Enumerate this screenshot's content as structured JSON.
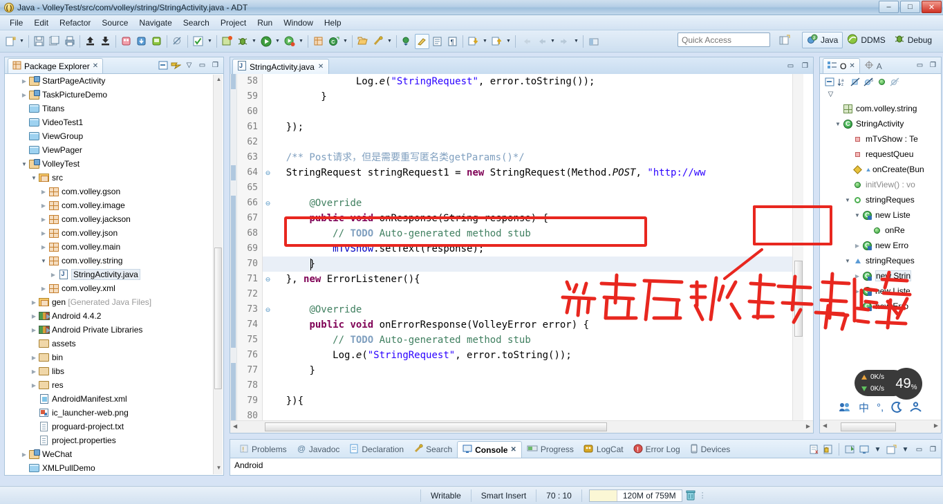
{
  "window": {
    "title": "Java - VolleyTest/src/com/volley/string/StringActivity.java - ADT",
    "app_icon": "adt-icon",
    "minimize": "–",
    "maximize": "□",
    "close": "✕"
  },
  "menu": [
    "File",
    "Edit",
    "Refactor",
    "Source",
    "Navigate",
    "Search",
    "Project",
    "Run",
    "Window",
    "Help"
  ],
  "toolbar": {
    "quick_access_placeholder": "Quick Access",
    "perspectives": [
      {
        "label": "Java",
        "active": true
      },
      {
        "label": "DDMS",
        "active": false
      },
      {
        "label": "Debug",
        "active": false
      }
    ]
  },
  "package_explorer": {
    "tab_label": "Package Explorer",
    "tree": [
      {
        "label": "StartPageActivity",
        "indent": 1,
        "arrow": "collapsed",
        "icon": "project-icon"
      },
      {
        "label": "TaskPictureDemo",
        "indent": 1,
        "arrow": "collapsed",
        "icon": "project-icon"
      },
      {
        "label": "Titans",
        "indent": 1,
        "arrow": "none",
        "icon": "folder-blue-icon"
      },
      {
        "label": "VideoTest1",
        "indent": 1,
        "arrow": "none",
        "icon": "folder-blue-icon"
      },
      {
        "label": "ViewGroup",
        "indent": 1,
        "arrow": "none",
        "icon": "folder-blue-icon"
      },
      {
        "label": "ViewPager",
        "indent": 1,
        "arrow": "none",
        "icon": "folder-blue-icon"
      },
      {
        "label": "VolleyTest",
        "indent": 1,
        "arrow": "expanded",
        "icon": "project-icon"
      },
      {
        "label": "src",
        "indent": 2,
        "arrow": "expanded",
        "icon": "source-folder-icon"
      },
      {
        "label": "com.volley.gson",
        "indent": 3,
        "arrow": "collapsed",
        "icon": "package-icon"
      },
      {
        "label": "com.volley.image",
        "indent": 3,
        "arrow": "collapsed",
        "icon": "package-icon"
      },
      {
        "label": "com.volley.jackson",
        "indent": 3,
        "arrow": "collapsed",
        "icon": "package-icon"
      },
      {
        "label": "com.volley.json",
        "indent": 3,
        "arrow": "collapsed",
        "icon": "package-icon"
      },
      {
        "label": "com.volley.main",
        "indent": 3,
        "arrow": "collapsed",
        "icon": "package-icon"
      },
      {
        "label": "com.volley.string",
        "indent": 3,
        "arrow": "expanded",
        "icon": "package-icon"
      },
      {
        "label": "StringActivity.java",
        "indent": 4,
        "arrow": "collapsed",
        "icon": "java-file-icon",
        "selected": true
      },
      {
        "label": "com.volley.xml",
        "indent": 3,
        "arrow": "collapsed",
        "icon": "package-icon"
      },
      {
        "label": "gen [Generated Java Files]",
        "indent": 2,
        "arrow": "collapsed",
        "icon": "source-folder-icon",
        "grey_suffix": true
      },
      {
        "label": "Android 4.4.2",
        "indent": 2,
        "arrow": "collapsed",
        "icon": "library-icon"
      },
      {
        "label": "Android Private Libraries",
        "indent": 2,
        "arrow": "collapsed",
        "icon": "library-icon"
      },
      {
        "label": "assets",
        "indent": 2,
        "arrow": "none",
        "icon": "folder-icon"
      },
      {
        "label": "bin",
        "indent": 2,
        "arrow": "collapsed",
        "icon": "folder-icon"
      },
      {
        "label": "libs",
        "indent": 2,
        "arrow": "collapsed",
        "icon": "folder-icon"
      },
      {
        "label": "res",
        "indent": 2,
        "arrow": "collapsed",
        "icon": "folder-icon"
      },
      {
        "label": "AndroidManifest.xml",
        "indent": 2,
        "arrow": "none",
        "icon": "xml-file-icon"
      },
      {
        "label": "ic_launcher-web.png",
        "indent": 2,
        "arrow": "none",
        "icon": "png-file-icon"
      },
      {
        "label": "proguard-project.txt",
        "indent": 2,
        "arrow": "none",
        "icon": "text-file-icon"
      },
      {
        "label": "project.properties",
        "indent": 2,
        "arrow": "none",
        "icon": "text-file-icon"
      },
      {
        "label": "WeChat",
        "indent": 1,
        "arrow": "collapsed",
        "icon": "project-icon"
      },
      {
        "label": "XMLPullDemo",
        "indent": 1,
        "arrow": "none",
        "icon": "folder-blue-icon"
      }
    ]
  },
  "editor": {
    "tab_label": "StringActivity.java",
    "tab_close": "✕",
    "lines": [
      {
        "no": "58",
        "fold": "",
        "indent": 8,
        "tokens": [
          {
            "t": "Log.",
            "c": "plain"
          },
          {
            "t": "e",
            "c": "it"
          },
          {
            "t": "(",
            "c": "plain"
          },
          {
            "t": "\"StringRequest\"",
            "c": "s"
          },
          {
            "t": ", error.toString());",
            "c": "plain"
          }
        ]
      },
      {
        "no": "59",
        "fold": "",
        "indent": 5,
        "tokens": [
          {
            "t": "}",
            "c": "plain"
          }
        ]
      },
      {
        "no": "60",
        "fold": "",
        "indent": 0,
        "tokens": []
      },
      {
        "no": "61",
        "fold": "",
        "indent": 2,
        "tokens": [
          {
            "t": "});",
            "c": "plain"
          }
        ]
      },
      {
        "no": "62",
        "fold": "",
        "indent": 0,
        "tokens": []
      },
      {
        "no": "63",
        "fold": "",
        "indent": 2,
        "tokens": [
          {
            "t": "/** Post请求，但是需要重写匿名类getParams()*/",
            "c": "jd"
          }
        ]
      },
      {
        "no": "64",
        "fold": "⊖",
        "indent": 2,
        "tokens": [
          {
            "t": "StringRequest stringRequest1 = ",
            "c": "plain"
          },
          {
            "t": "new",
            "c": "k"
          },
          {
            "t": " StringRequest(Method.",
            "c": "plain"
          },
          {
            "t": "POST",
            "c": "it"
          },
          {
            "t": ", ",
            "c": "plain"
          },
          {
            "t": "\"http://ww",
            "c": "s"
          }
        ]
      },
      {
        "no": "65",
        "fold": "",
        "indent": 0,
        "tokens": []
      },
      {
        "no": "66",
        "fold": "⊖",
        "indent": 4,
        "tokens": [
          {
            "t": "@Override",
            "c": "cm"
          }
        ]
      },
      {
        "no": "67",
        "fold": "",
        "indent": 4,
        "tokens": [
          {
            "t": "public void",
            "c": "k"
          },
          {
            "t": " onResponse(String response) {",
            "c": "plain"
          }
        ]
      },
      {
        "no": "68",
        "fold": "",
        "indent": 6,
        "tokens": [
          {
            "t": "// ",
            "c": "cm"
          },
          {
            "t": "TODO",
            "c": "td"
          },
          {
            "t": " Auto-generated method stub",
            "c": "cm"
          }
        ]
      },
      {
        "no": "69",
        "fold": "",
        "indent": 6,
        "tokens": [
          {
            "t": "mTvShow",
            "c": "fl"
          },
          {
            "t": ".setText(response);",
            "c": "plain"
          }
        ]
      },
      {
        "no": "70",
        "fold": "",
        "indent": 4,
        "tokens": [
          {
            "t": "}",
            "c": "plain"
          }
        ],
        "current": true
      },
      {
        "no": "71",
        "fold": "⊖",
        "indent": 2,
        "tokens": [
          {
            "t": "}, ",
            "c": "plain"
          },
          {
            "t": "new",
            "c": "k"
          },
          {
            "t": " ErrorListener(){",
            "c": "plain"
          }
        ]
      },
      {
        "no": "72",
        "fold": "",
        "indent": 0,
        "tokens": []
      },
      {
        "no": "73",
        "fold": "⊖",
        "indent": 4,
        "tokens": [
          {
            "t": "@Override",
            "c": "cm"
          }
        ]
      },
      {
        "no": "74",
        "fold": "",
        "indent": 4,
        "tokens": [
          {
            "t": "public void",
            "c": "k"
          },
          {
            "t": " onErrorResponse(VolleyError error) {",
            "c": "plain"
          }
        ]
      },
      {
        "no": "75",
        "fold": "",
        "indent": 6,
        "tokens": [
          {
            "t": "// ",
            "c": "cm"
          },
          {
            "t": "TODO",
            "c": "td"
          },
          {
            "t": " Auto-generated method stub",
            "c": "cm"
          }
        ]
      },
      {
        "no": "76",
        "fold": "",
        "indent": 6,
        "tokens": [
          {
            "t": "Log.",
            "c": "plain"
          },
          {
            "t": "e",
            "c": "it"
          },
          {
            "t": "(",
            "c": "plain"
          },
          {
            "t": "\"StringRequest\"",
            "c": "s"
          },
          {
            "t": ", error.toString());",
            "c": "plain"
          }
        ]
      },
      {
        "no": "77",
        "fold": "",
        "indent": 4,
        "tokens": [
          {
            "t": "}",
            "c": "plain"
          }
        ]
      },
      {
        "no": "78",
        "fold": "",
        "indent": 0,
        "tokens": []
      },
      {
        "no": "79",
        "fold": "",
        "indent": 2,
        "tokens": [
          {
            "t": "}){",
            "c": "plain"
          }
        ]
      },
      {
        "no": "80",
        "fold": "",
        "indent": 0,
        "tokens": []
      }
    ]
  },
  "outline": {
    "tab_label": "O",
    "tab_label2": "A",
    "tree": [
      {
        "label": "com.volley.string",
        "indent": 1,
        "arrow": "none",
        "icon": "package-icon"
      },
      {
        "label": "StringActivity",
        "indent": 1,
        "arrow": "expanded",
        "icon": "class-icon"
      },
      {
        "label": "mTvShow : Te",
        "indent": 2,
        "arrow": "none",
        "icon": "field-private-icon"
      },
      {
        "label": "requestQueu",
        "indent": 2,
        "arrow": "none",
        "icon": "field-private-icon"
      },
      {
        "label": "onCreate(Bun",
        "indent": 2,
        "arrow": "none",
        "icon": "method-protected-icon"
      },
      {
        "label": "initView() : vo",
        "indent": 2,
        "arrow": "none",
        "icon": "method-public-icon",
        "grey": true
      },
      {
        "label": "stringReques",
        "indent": 2,
        "arrow": "expanded",
        "icon": "local-var-icon"
      },
      {
        "label": "new Liste",
        "indent": 3,
        "arrow": "expanded",
        "icon": "anon-class-icon"
      },
      {
        "label": "onRe",
        "indent": 4,
        "arrow": "none",
        "icon": "method-public-icon"
      },
      {
        "label": "new Erro",
        "indent": 3,
        "arrow": "collapsed",
        "icon": "anon-class-icon"
      },
      {
        "label": "stringReques",
        "indent": 2,
        "arrow": "expanded",
        "icon": "local-var2-icon"
      },
      {
        "label": "new Strin",
        "indent": 3,
        "arrow": "collapsed",
        "icon": "anon-class-icon",
        "selected": true
      },
      {
        "label": "new Liste",
        "indent": 3,
        "arrow": "collapsed",
        "icon": "anon-class-icon"
      },
      {
        "label": "new Erro",
        "indent": 3,
        "arrow": "none",
        "icon": "anon-class-icon"
      }
    ]
  },
  "console": {
    "tabs": [
      {
        "label": "Problems",
        "icon": "problems-icon",
        "active": false
      },
      {
        "label": "Javadoc",
        "icon": "javadoc-icon",
        "active": false
      },
      {
        "label": "Declaration",
        "icon": "declaration-icon",
        "active": false
      },
      {
        "label": "Search",
        "icon": "search-icon",
        "active": false
      },
      {
        "label": "Console",
        "icon": "console-icon",
        "active": true
      },
      {
        "label": "Progress",
        "icon": "progress-icon",
        "active": false
      },
      {
        "label": "LogCat",
        "icon": "logcat-icon",
        "active": false
      },
      {
        "label": "Error Log",
        "icon": "errorlog-icon",
        "active": false
      },
      {
        "label": "Devices",
        "icon": "devices-icon",
        "active": false
      }
    ],
    "tab_close": "✕",
    "body_text": "Android"
  },
  "statusbar": {
    "writable": "Writable",
    "insert_mode": "Smart Insert",
    "cursor": "70 : 10",
    "memory": "120M of 759M",
    "trash_icon": "trash-icon"
  },
  "annotations": {
    "code_box": "red-rectangle-around-onResponse",
    "outline_box": "red-rectangle-in-outline",
    "handwriting": "点击后，跳转到该方法"
  },
  "speed_widget": {
    "upload": "0K/s",
    "download": "0K/s",
    "percent": "49",
    "percent_unit": "%"
  },
  "ime_bar": {
    "items": [
      "people-icon",
      "中",
      "°,",
      "moon-icon",
      "person-icon",
      "grid-icon"
    ]
  }
}
